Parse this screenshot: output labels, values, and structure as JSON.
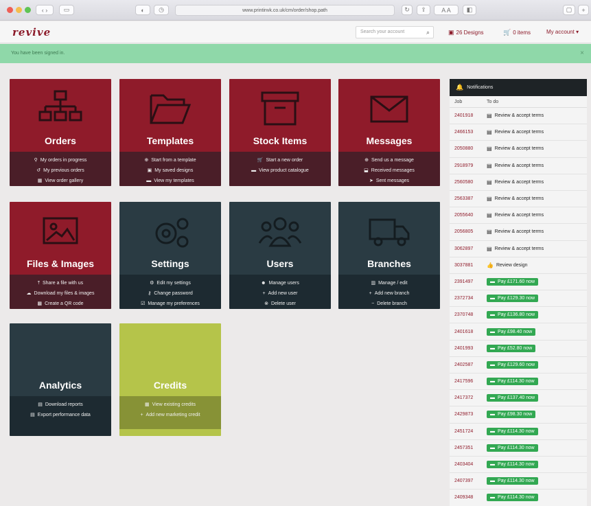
{
  "browser": {
    "url": "www.printinvk.co.uk/cm/order/shop.path"
  },
  "header": {
    "logo": "revive",
    "search_placeholder": "Search your account",
    "designs": "26 Designs",
    "items": "0 items",
    "account": "My account ▾"
  },
  "alert": {
    "text": "You have been signed in."
  },
  "tiles": [
    {
      "title": "Orders",
      "links": [
        "My orders in progress",
        "My previous orders",
        "View order gallery"
      ]
    },
    {
      "title": "Templates",
      "links": [
        "Start from a template",
        "My saved designs",
        "View my templates"
      ]
    },
    {
      "title": "Stock Items",
      "links": [
        "Start a new order",
        "View product catalogue"
      ]
    },
    {
      "title": "Messages",
      "links": [
        "Send us a message",
        "Received messages",
        "Sent messages"
      ]
    },
    {
      "title": "Files & Images",
      "links": [
        "Share a file with us",
        "Download my files & images",
        "Create a QR code"
      ]
    },
    {
      "title": "Settings",
      "links": [
        "Edit my settings",
        "Change password",
        "Manage my preferences"
      ]
    },
    {
      "title": "Users",
      "links": [
        "Manage users",
        "Add new user",
        "Delete user"
      ]
    },
    {
      "title": "Branches",
      "links": [
        "Manage / edit",
        "Add new branch",
        "Delete branch"
      ]
    },
    {
      "title": "Analytics",
      "links": [
        "Download reports",
        "Export performance data"
      ]
    },
    {
      "title": "Credits",
      "links": [
        "View existing credits",
        "Add new marketing credit"
      ]
    }
  ],
  "notifications": {
    "title": "Notifications",
    "col_job": "Job",
    "col_todo": "To do",
    "rows": [
      {
        "job": "2401918",
        "todo": "Review & accept terms",
        "type": "review"
      },
      {
        "job": "2466153",
        "todo": "Review & accept terms",
        "type": "review"
      },
      {
        "job": "2050880",
        "todo": "Review & accept terms",
        "type": "review"
      },
      {
        "job": "2918979",
        "todo": "Review & accept terms",
        "type": "review"
      },
      {
        "job": "2560580",
        "todo": "Review & accept terms",
        "type": "review"
      },
      {
        "job": "2563387",
        "todo": "Review & accept terms",
        "type": "review"
      },
      {
        "job": "2055640",
        "todo": "Review & accept terms",
        "type": "review"
      },
      {
        "job": "2056805",
        "todo": "Review & accept terms",
        "type": "review"
      },
      {
        "job": "3062897",
        "todo": "Review & accept terms",
        "type": "review"
      },
      {
        "job": "3037881",
        "todo": "Review design",
        "type": "design"
      },
      {
        "job": "2391497",
        "todo": "Pay £171.60 now",
        "type": "pay"
      },
      {
        "job": "2372734",
        "todo": "Pay £129.30 now",
        "type": "pay"
      },
      {
        "job": "2370748",
        "todo": "Pay £136.80 now",
        "type": "pay"
      },
      {
        "job": "2401618",
        "todo": "Pay £98.40 now",
        "type": "pay"
      },
      {
        "job": "2401993",
        "todo": "Pay £52.80 now",
        "type": "pay"
      },
      {
        "job": "2402587",
        "todo": "Pay £129.60 now",
        "type": "pay"
      },
      {
        "job": "2417596",
        "todo": "Pay £114.30 now",
        "type": "pay"
      },
      {
        "job": "2417372",
        "todo": "Pay £137.40 now",
        "type": "pay"
      },
      {
        "job": "2429873",
        "todo": "Pay £98.30 now",
        "type": "pay"
      },
      {
        "job": "2451724",
        "todo": "Pay £114.30 now",
        "type": "pay"
      },
      {
        "job": "2457351",
        "todo": "Pay £114.30 now",
        "type": "pay"
      },
      {
        "job": "2403404",
        "todo": "Pay £114.30 now",
        "type": "pay"
      },
      {
        "job": "2407397",
        "todo": "Pay £114.30 now",
        "type": "pay"
      },
      {
        "job": "2409348",
        "todo": "Pay £114.30 now",
        "type": "pay"
      }
    ]
  },
  "colors": {
    "brand": "#8f1b2a",
    "dark": "#2a3b43",
    "lime": "#b5c44a",
    "pay": "#32a852"
  }
}
